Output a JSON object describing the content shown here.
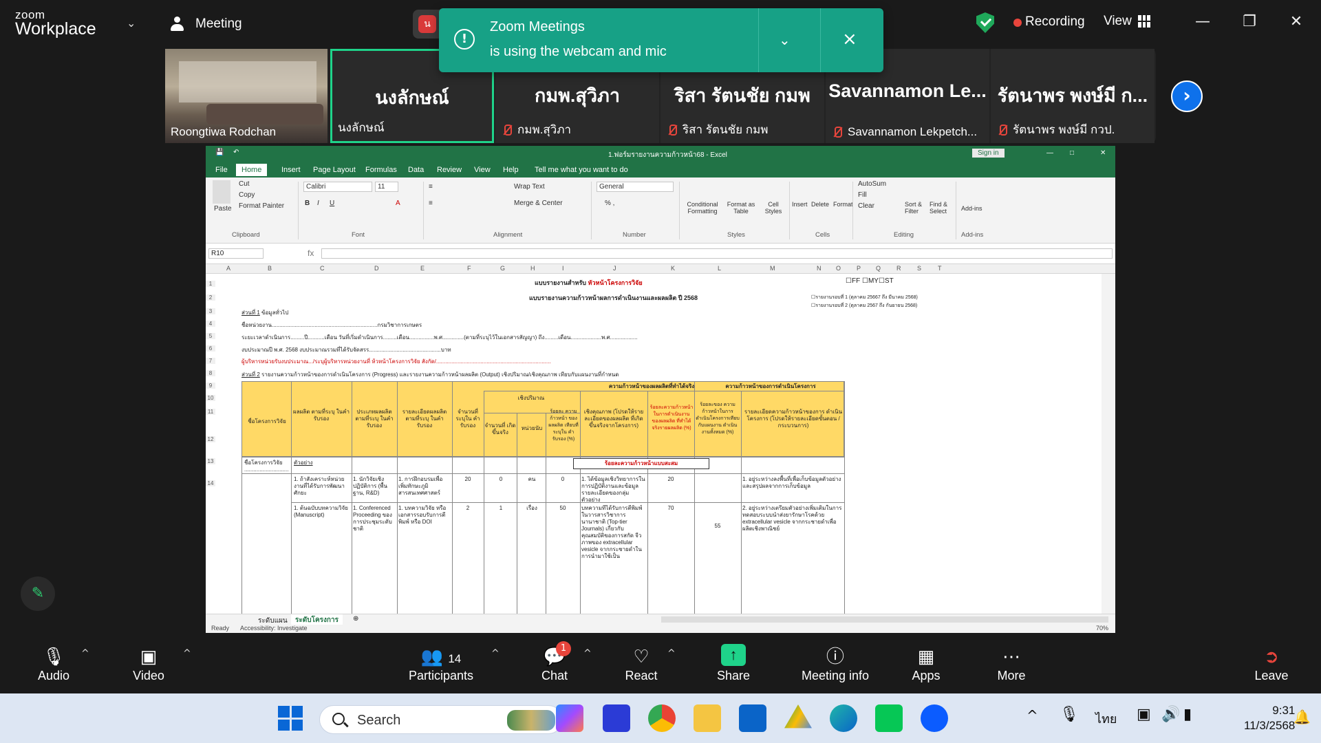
{
  "app": {
    "brand_small": "zoom",
    "brand_big": "Workplace",
    "meeting_tab": "Meeting",
    "speaker_short": "น"
  },
  "status": {
    "recording": "Recording",
    "view": "View"
  },
  "toast": {
    "title": "Zoom Meetings",
    "message": "is using the webcam and mic"
  },
  "gallery": [
    {
      "name": "",
      "label": "Roongtiwa Rodchan",
      "muted": false
    },
    {
      "name": "นงลักษณ์",
      "label": "นงลักษณ์",
      "muted": false,
      "active": true
    },
    {
      "name": "กมพ.สุวิภา",
      "label": "กมพ.สุวิภา",
      "muted": true
    },
    {
      "name": "ริสา รัตนชัย กมพ",
      "label": "ริสา รัตนชัย กมพ",
      "muted": true
    },
    {
      "name": "Savannamon Le...",
      "label": "Savannamon Lekpetch...",
      "muted": true
    },
    {
      "name": "รัตนาพร พงษ์มี ก...",
      "label": "รัตนาพร พงษ์มี กวป.",
      "muted": true
    }
  ],
  "excel": {
    "filename": "1.ฟอร์มรายงานความก้าวหน้า68 - Excel",
    "sign_in": "Sign in",
    "tabs": [
      "File",
      "Home",
      "Insert",
      "Page Layout",
      "Formulas",
      "Data",
      "Review",
      "View",
      "Help",
      "Tell me what you want to do"
    ],
    "clipboard": {
      "paste": "Paste",
      "cut": "Cut",
      "copy": "Copy",
      "format_painter": "Format Painter",
      "group": "Clipboard"
    },
    "font": {
      "name": "Calibri",
      "size": "11",
      "group": "Font"
    },
    "alignment": {
      "wrap": "Wrap Text",
      "merge": "Merge & Center",
      "group": "Alignment"
    },
    "number": {
      "format": "General",
      "group": "Number"
    },
    "styles": {
      "cond": "Conditional Formatting",
      "table": "Format as Table",
      "cell": "Cell Styles",
      "group": "Styles"
    },
    "cells": {
      "insert": "Insert",
      "delete": "Delete",
      "format": "Format",
      "group": "Cells"
    },
    "editing": {
      "autosum": "AutoSum",
      "fill": "Fill",
      "clear": "Clear",
      "sort": "Sort & Filter",
      "find": "Find & Select",
      "group": "Editing"
    },
    "addins": {
      "label": "Add-ins",
      "group": "Add-ins"
    },
    "name_box": "R10",
    "columns": [
      "A",
      "B",
      "C",
      "D",
      "E",
      "F",
      "G",
      "H",
      "I",
      "J",
      "K",
      "L",
      "M",
      "N",
      "O",
      "P",
      "Q",
      "R",
      "S",
      "T"
    ],
    "rows": [
      "1",
      "2",
      "3",
      "4",
      "5",
      "6",
      "7",
      "8",
      "9",
      "10",
      "11",
      "12",
      "13",
      "14"
    ],
    "sheet": {
      "title1": "แบบรายงานสำหรับ",
      "title1_red": "หัวหน้าโครงการวิจัย",
      "title2": "แบบรายงานความก้าวหน้าผลการดำเนินงานและผลผลิต ปี 2568",
      "opt_ff": "FF",
      "opt_my": "MY",
      "opt_st": "ST",
      "round1": "รายงานรอบที่ 1  (ตุลาคม 25667 ถึง มีนาคม 2568)",
      "round2": "รายงานรอบที่ 2  (ตุลาคม 2567 ถึง กันยายน 2568)",
      "part1": "ส่วนที่ 1",
      "part1_text": "ข้อมูลทั่วไป",
      "r4": "ชื่อหน่วยงาน.....................................................................กรมวิชาการเกษตร",
      "r5": "ระยะเวลาดำเนินการ.........ปี...........เดือน  วันที่เริ่มดำเนินการ.........เดือน................พ.ศ..............(ตามที่ระบุไว้ในเอกสารสัญญา) ถึง.........เดือน....................พ.ศ..................",
      "r6": "งบประมาณปี พ.ศ. 2568  งบประมาณรวมที่ได้รับจัดสรร...............................................บาท",
      "r7": "ผู้บริหารหน่วยรับงบประมาณ.../ระบุผู้บริหารหน่วยงานที่ ห้วหน้าโครงการวิจัย สังกัด/...........................................................................",
      "part2": "ส่วนที่ 2",
      "part2_text": "รายงานความก้าวหน้าของการดำเนินโครงการ (Progress) และรายงานความก้าวหน้าผลผลิต (Output) เชิงปริมาณ/เชิงคุณภาพ เทียบกับแผนงานที่กำหนด",
      "h_progress": "ความก้าวหน้าของผลผลิตที่ทำได้จริง",
      "h_project": "ความก้าวหน้าของการดำเนินโครงการ",
      "h_project_name": "ชื่อโครงการวิจัย",
      "h_output": "ผลผลิต ตามที่ระบุ ในคำรับรอง",
      "h_type": "ประเภทผลผลิต ตามที่ระบุ ในคำรับรอง",
      "h_detail": "รายละเอียดผลผลิต ตามที่ระบุ ในคำรับรอง",
      "h_amount": "จำนวนที่ ระบุใน คำรับรอง",
      "h_quantity": "เชิงปริมาณ",
      "h_actual": "จำนวนที่ เกิดขึ้นจริง",
      "h_unit": "หน่วยนับ",
      "h_pct": "ร้อยละ ความก้าวหน้า ของผลผลิต เทียบที่ระบุใน คำรับรอง (%)",
      "h_quality": "เชิงคุณภาพ (โปรดให้รายละเอียดของผลผลิต ที่เกิดขึ้นจริงจากโครงการ)",
      "h_pct_red": "ร้อยละความก้าวหน้า ในการดำเนินงาน ของผลผลิต ที่ทำได้จริงรายผลผลิต (%)",
      "h_proj_pct": "ร้อยละของ ความก้าวหน้าในการ ดำเนินโครงการเทียบ กับแผนงาน ดำเนินงานทั้งหมด (%)",
      "h_proj_detail": "รายละเอียดความก้าวหน้าของการ ดำเนินโครงการ (โปรดให้รายละเอียดขั้นตอน / กระบวนการ)",
      "r13_name": "ชื่อโครงการวิจัย",
      "r13_dots": ".............................",
      "r13_example": "ตัวอย่าง",
      "r13_box": "ร้อยละความก้าวหน้าแบบสะสม",
      "r14a": [
        "1. ถ้าสังเคราะห์หน่วยงานที่ได้รับการพัฒนาศักยะ",
        "1. นักวิจัยเชิงปฏิบัติการ (พื้นฐาน, R&D)",
        "1. การฝึกอบรมเพื่อเพิ่มทักษะภูมิสารสนเทศศาสตร์",
        "20",
        "0",
        "คน",
        "0",
        "1. ได้ข้อมูลเชิงวิทยาการในการปฏิบัติงานและข้อมูลรายละเอียดของกลุ่มตัวอย่าง",
        "20",
        "",
        "1. อยู่ระหว่างลงพื้นที่เพื่อเก็บข้อมูลตัวอย่าง และสรุปผลจากการเก็บข้อมูล"
      ],
      "r14b": [
        "1. ต้นฉบับบทความวิจัย (Manuscript)",
        "1. Conferenced Proceeding ของการประชุมระดับชาติ",
        "1. บทความวิจัย หรือเอกสารรอบรับการตีพิมพ์ หรือ DOI",
        "2",
        "1",
        "เรื่อง",
        "50",
        "บทความที่ได้รับการตีพิมพ์ในวารสารวิชาการนานาชาติ (Top-tier Journals) เกี่ยวกับคุณสมบัติของการสกัด จีวภาพของ extracellular vesicle จากกระชายดำในการนำมาใช้เป็น",
        "70",
        "55",
        "2. อยู่ระหว่างเตรียมตัวอย่างเพิ่มเติมในการทดสอบระบบนำส่งยารักษาโรคด้วย extracellular vesicle จากกระชายดำเพื่อผลิตเชิงพาณิชย์"
      ]
    },
    "sheet_tabs": [
      "ระดับแผน",
      "ระดับโครงการ"
    ],
    "status_ready": "Ready",
    "status_access": "Accessibility: Investigate",
    "zoom_pct": "70%"
  },
  "bottombar": {
    "audio": "Audio",
    "video": "Video",
    "participants": "Participants",
    "participants_count": "14",
    "chat": "Chat",
    "chat_badge": "1",
    "react": "React",
    "share": "Share",
    "meeting_info": "Meeting info",
    "apps": "Apps",
    "more": "More",
    "leave": "Leave"
  },
  "taskbar": {
    "search": "Search",
    "lang": "ไทย",
    "time": "9:31",
    "date": "11/3/2568"
  }
}
